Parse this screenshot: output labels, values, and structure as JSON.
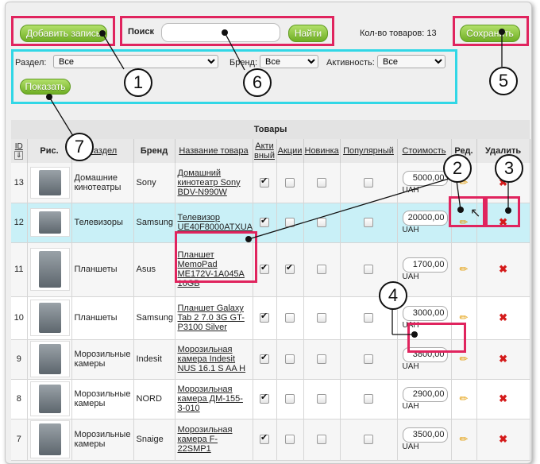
{
  "toolbar": {
    "add_label": "Добавить запись",
    "search_label": "Поиск",
    "search_value": "",
    "find_label": "Найти",
    "count_label": "Кол-во товаров: 13",
    "save_label": "Сохранить"
  },
  "filters": {
    "section_label": "Раздел:",
    "section_value": "Все",
    "brand_label": "Бренд:",
    "brand_value": "Все",
    "activity_label": "Активность:",
    "activity_value": "Все",
    "show_label": "Показать"
  },
  "table": {
    "title": "Товары",
    "headers": {
      "id": "ID",
      "pic": "Рис.",
      "section": "Раздел",
      "brand": "Бренд",
      "name": "Название товара",
      "active": "Активный",
      "sale": "Акции",
      "new": "Новинка",
      "popular": "Популярный",
      "price": "Стоимость",
      "edit": "Ред.",
      "delete": "Удалить"
    },
    "currency": "UAH",
    "rows": [
      {
        "id": "13",
        "section": "Домашние кинотеатры",
        "brand": "Sony",
        "name": "Домашний кинотеатр Sony BDV-N990W",
        "active": true,
        "sale": false,
        "new": false,
        "popular": false,
        "price": "5000,00"
      },
      {
        "id": "12",
        "section": "Телевизоры",
        "brand": "Samsung",
        "name": "Телевизор UE40F8000ATXUA",
        "active": true,
        "sale": false,
        "new": false,
        "popular": false,
        "price": "20000,00"
      },
      {
        "id": "11",
        "section": "Планшеты",
        "brand": "Asus",
        "name": "Планшет MemoPad ME172V-1A045A 16GB",
        "active": true,
        "sale": true,
        "new": false,
        "popular": false,
        "price": "1700,00"
      },
      {
        "id": "10",
        "section": "Планшеты",
        "brand": "Samsung",
        "name": "Планшет Galaxy Tab 2 7.0 3G GT-P3100 Silver",
        "active": true,
        "sale": false,
        "new": false,
        "popular": false,
        "price": "3000,00"
      },
      {
        "id": "9",
        "section": "Морозильные камеры",
        "brand": "Indesit",
        "name": "Морозильная камера Indesit NUS 16.1 S AA H",
        "active": true,
        "sale": false,
        "new": false,
        "popular": false,
        "price": "3800,00"
      },
      {
        "id": "8",
        "section": "Морозильные камеры",
        "brand": "NORD",
        "name": "Морозильная камера ДМ-155-3-010",
        "active": true,
        "sale": false,
        "new": false,
        "popular": false,
        "price": "2900,00"
      },
      {
        "id": "7",
        "section": "Морозильные камеры",
        "brand": "Snaige",
        "name": "Морозильная камера F-22SMP1",
        "active": true,
        "sale": false,
        "new": false,
        "popular": false,
        "price": "3500,00"
      }
    ]
  },
  "callouts": [
    "1",
    "2",
    "3",
    "4",
    "5",
    "6",
    "7"
  ],
  "colors": {
    "highlight": "#e0245e",
    "filter_box": "#31d7e6",
    "button": "#7cbc2e",
    "selected_row": "#c9f0f7"
  }
}
